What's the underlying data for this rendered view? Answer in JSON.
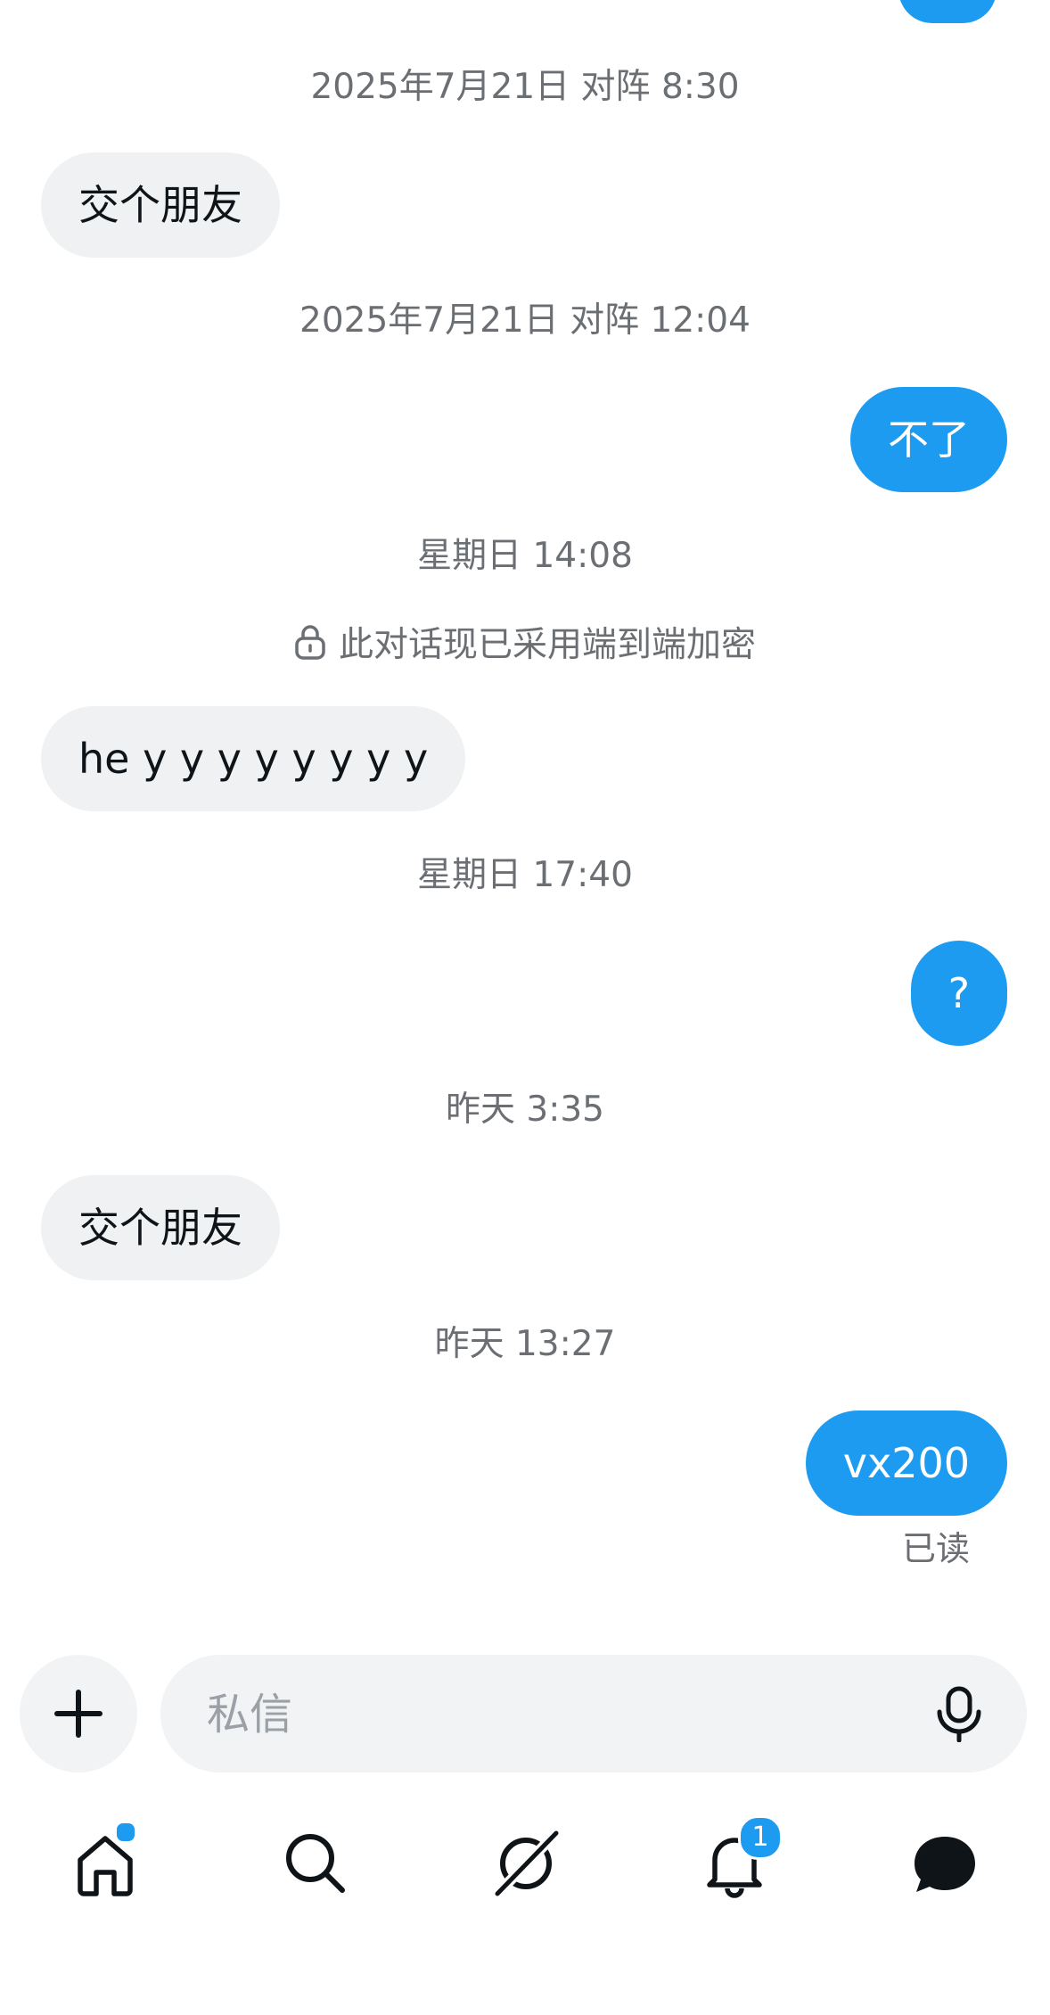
{
  "colors": {
    "accent": "#1d9bf0",
    "incoming_bubble": "#eff1f2",
    "timestamp_text": "#6b6f73"
  },
  "conversation": {
    "timestamps": [
      "2025年7月21日 对阵 8:30",
      "2025年7月21日 对阵 12:04",
      "星期日 14:08",
      "星期日 17:40",
      "昨天 3:35",
      "昨天 13:27"
    ],
    "encryption_notice": "此对话现已采用端到端加密",
    "messages": [
      {
        "direction": "in",
        "text": "交个朋友"
      },
      {
        "direction": "out",
        "text": "不了"
      },
      {
        "direction": "in",
        "text": "he y y y y y y y y"
      },
      {
        "direction": "out",
        "text": "?"
      },
      {
        "direction": "in",
        "text": "交个朋友"
      },
      {
        "direction": "out",
        "text": "vx200"
      }
    ],
    "read_receipt": "已读"
  },
  "composer": {
    "placeholder": "私信",
    "add_icon": "plus-icon",
    "voice_icon": "microphone-icon"
  },
  "nav": {
    "items": [
      {
        "icon": "home-icon",
        "has_dot": true
      },
      {
        "icon": "search-icon"
      },
      {
        "icon": "grok-icon"
      },
      {
        "icon": "bell-icon",
        "badge": "1"
      },
      {
        "icon": "messages-icon",
        "active": true
      }
    ]
  }
}
